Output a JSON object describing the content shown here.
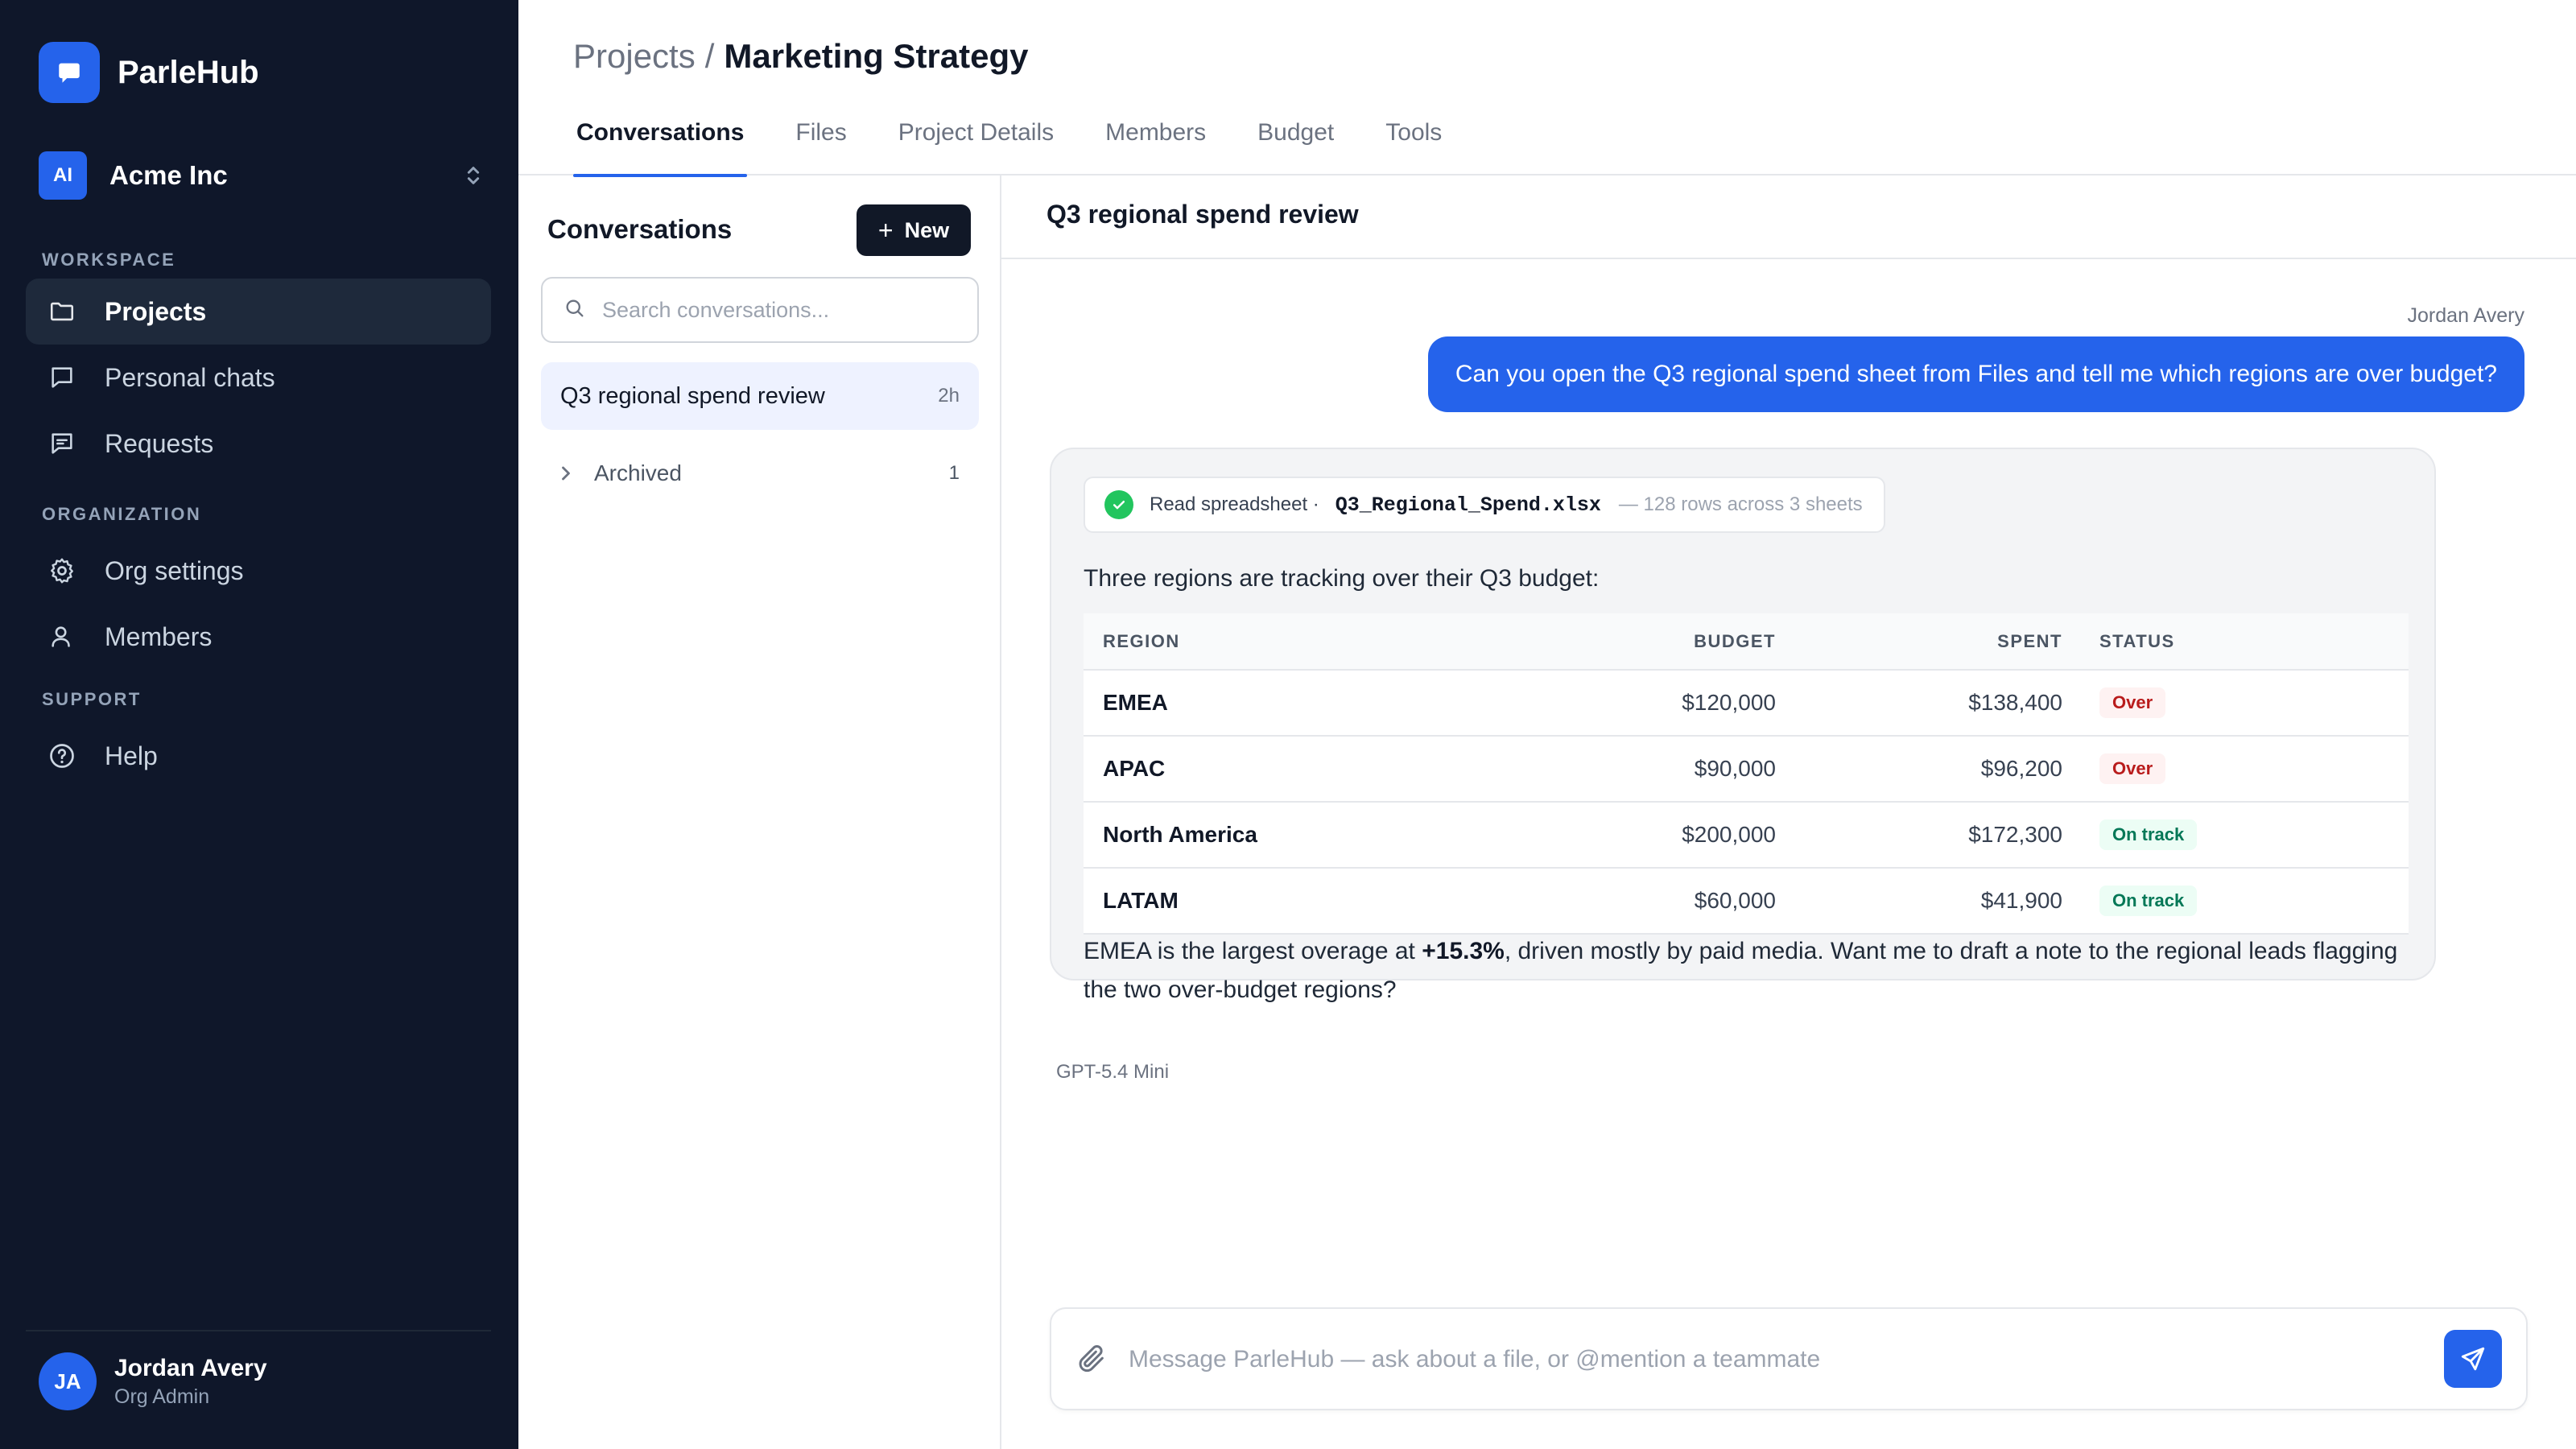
{
  "app": {
    "name": "ParleHub",
    "org": {
      "initials": "AI",
      "name": "Acme Inc"
    }
  },
  "sidebar": {
    "sections": [
      {
        "label": "WORKSPACE"
      },
      {
        "label": "ORGANIZATION"
      },
      {
        "label": "SUPPORT"
      }
    ],
    "items": [
      {
        "label": "Projects",
        "icon": "folder-icon",
        "active": true
      },
      {
        "label": "Personal chats",
        "icon": "chat-bubble-icon"
      },
      {
        "label": "Requests",
        "icon": "message-lines-icon"
      },
      {
        "label": "Org settings",
        "icon": "gear-icon"
      },
      {
        "label": "Members",
        "icon": "user-icon"
      },
      {
        "label": "Help",
        "icon": "help-circle-icon"
      }
    ],
    "user": {
      "initials": "JA",
      "name": "Jordan Avery",
      "role": "Org Admin"
    }
  },
  "header": {
    "breadcrumb": {
      "parent": "Projects",
      "separator": "/",
      "current": "Marketing Strategy"
    },
    "tabs": [
      {
        "label": "Conversations",
        "active": true
      },
      {
        "label": "Files"
      },
      {
        "label": "Project Details"
      },
      {
        "label": "Members"
      },
      {
        "label": "Budget"
      },
      {
        "label": "Tools"
      }
    ]
  },
  "conversations": {
    "title": "Conversations",
    "new_label": "New",
    "search_placeholder": "Search conversations...",
    "items": [
      {
        "title": "Q3 regional spend review",
        "time": "2h",
        "active": true
      }
    ],
    "archived": {
      "label": "Archived",
      "count": "1"
    }
  },
  "chat": {
    "title": "Q3 regional spend review",
    "user_message": {
      "sender": "Jordan Avery",
      "text": "Can you open the Q3 regional spend sheet from Files and tell me which regions are over budget?"
    },
    "assistant": {
      "tool_call": {
        "label": "Read spreadsheet ·",
        "file": "Q3_Regional_Spend.xlsx",
        "meta": "— 128 rows across 3 sheets"
      },
      "intro": "Three regions are tracking over their Q3 budget:",
      "table": {
        "headers": [
          "REGION",
          "BUDGET",
          "SPENT",
          "STATUS"
        ],
        "rows": [
          {
            "region": "EMEA",
            "budget": "$120,000",
            "spent": "$138,400",
            "status": "Over"
          },
          {
            "region": "APAC",
            "budget": "$90,000",
            "spent": "$96,200",
            "status": "Over"
          },
          {
            "region": "North America",
            "budget": "$200,000",
            "spent": "$172,300",
            "status": "On track"
          },
          {
            "region": "LATAM",
            "budget": "$60,000",
            "spent": "$41,900",
            "status": "On track"
          }
        ]
      },
      "summary_pre": "EMEA is the largest overage at ",
      "summary_bold": "+15.3%",
      "summary_post": ", driven mostly by paid media. Want me to draft a note to the regional leads flagging the two over-budget regions?",
      "model": "GPT-5.4 Mini"
    },
    "composer": {
      "placeholder": "Message ParleHub — ask about a file, or @mention a teammate"
    }
  },
  "colors": {
    "accent": "#2563eb",
    "sidebar_bg": "#0f172a",
    "over": "#b91c1c",
    "on_track": "#047857",
    "success": "#22c55e"
  }
}
